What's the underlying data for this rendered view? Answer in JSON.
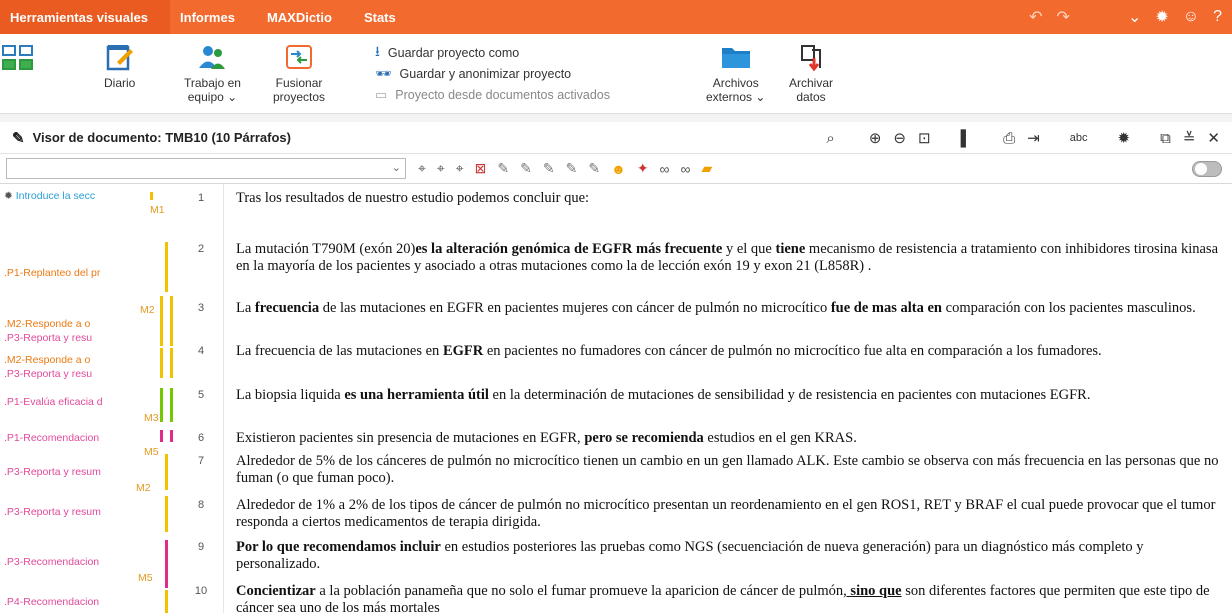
{
  "menubar": {
    "tabs": [
      "Herramientas visuales",
      "Informes",
      "MAXDictio",
      "Stats"
    ]
  },
  "ribbon": {
    "diario": "Diario",
    "trabajo_l1": "Trabajo en",
    "trabajo_l2": "equipo ⌄",
    "fusionar_l1": "Fusionar",
    "fusionar_l2": "proyectos",
    "guardar_como": "Guardar proyecto como",
    "guardar_anon": "Guardar y anonimizar proyecto",
    "proyecto_desde": "Proyecto desde documentos activados",
    "archivos_l1": "Archivos",
    "archivos_l2": "externos ⌄",
    "archivar_l1": "Archivar",
    "archivar_l2": "datos"
  },
  "viewer": {
    "title": "Visor de documento: TMB10   (10 Párrafos)"
  },
  "codes": [
    {
      "label": "Introduce la secc",
      "memo": "M1"
    },
    {
      "label": ".P1-Replanteo del pr"
    },
    {
      "label": ".M2-Responde a o",
      "memo": "M2"
    },
    {
      "label": ".P3-Reporta y resu"
    },
    {
      "label": ".M2-Responde a o"
    },
    {
      "label": ".P3-Reporta y resu"
    },
    {
      "label": ".P1-Evalúa eficacia d",
      "memo": "M3"
    },
    {
      "label": ".P1-Recomendacion",
      "memo": "M5"
    },
    {
      "label": ".P3-Reporta y resum",
      "memo": "M2"
    },
    {
      "label": ".P3-Reporta y resum"
    },
    {
      "label": ".P3-Recomendacion",
      "memo": "M5"
    },
    {
      "label": ".P4-Recomendacion"
    }
  ],
  "paragraphs": [
    {
      "num": "1",
      "html": "Tras los resultados de nuestro estudio podemos concluir que:"
    },
    {
      "num": "2",
      "html": "La mutación T790M (exón 20)<b>es la alteración genómica de EGFR más frecuente</b> y el que <b>tiene</b> mecanismo de resistencia a tratamiento con inhibidores tirosina kinasa en la mayoría de los pacientes y asociado a otras mutaciones como la de lección exón 19 y exon 21 (L858R) ."
    },
    {
      "num": "3",
      "html": "La <b>frecuencia</b> de las mutaciones en EGFR en pacientes mujeres con cáncer de pulmón no microcítico <b>fue de mas alta en</b> comparación con los pacientes masculinos."
    },
    {
      "num": "4",
      "html": "La frecuencia de las mutaciones en <b>EGFR</b> en pacientes no fumadores con cáncer de pulmón no microcítico fue alta en comparación a los fumadores."
    },
    {
      "num": "5",
      "html": "La biopsia liquida <b>es una herramienta útil</b> en la determinación de mutaciones de  sensibilidad y de resistencia en pacientes con mutaciones EGFR."
    },
    {
      "num": "6",
      "html": "Existieron pacientes sin presencia de mutaciones en EGFR,  <b>pero se recomienda</b> estudios en el gen KRAS."
    },
    {
      "num": "7",
      "html": "Alrededor de 5% de los cánceres de pulmón no microcítico tienen un cambio en un gen llamado ALK. Este cambio se observa con más frecuencia en las personas que no fuman (o que fuman poco)."
    },
    {
      "num": "8",
      "html": "Alrededor de 1% a 2% de los tipos de cáncer de pulmón no microcítico presentan un reordenamiento en el gen ROS1, RET y BRAF el cual puede provocar que el tumor responda a ciertos medicamentos de terapia dirigida."
    },
    {
      "num": "9",
      "html": "<b>Por lo que recomendamos incluir</b> en estudios posteriores las pruebas como NGS (secuenciación de nueva generación) para un diagnóstico más completo y personalizado."
    },
    {
      "num": "10",
      "html": "<b>Concientizar</b> a la población panameña que no solo el fumar promueve la aparicion de cáncer de pulmón<u>, <b>sino que</b></u> son diferentes factores que permiten que este tipo de cáncer sea uno de los más mortales"
    }
  ]
}
